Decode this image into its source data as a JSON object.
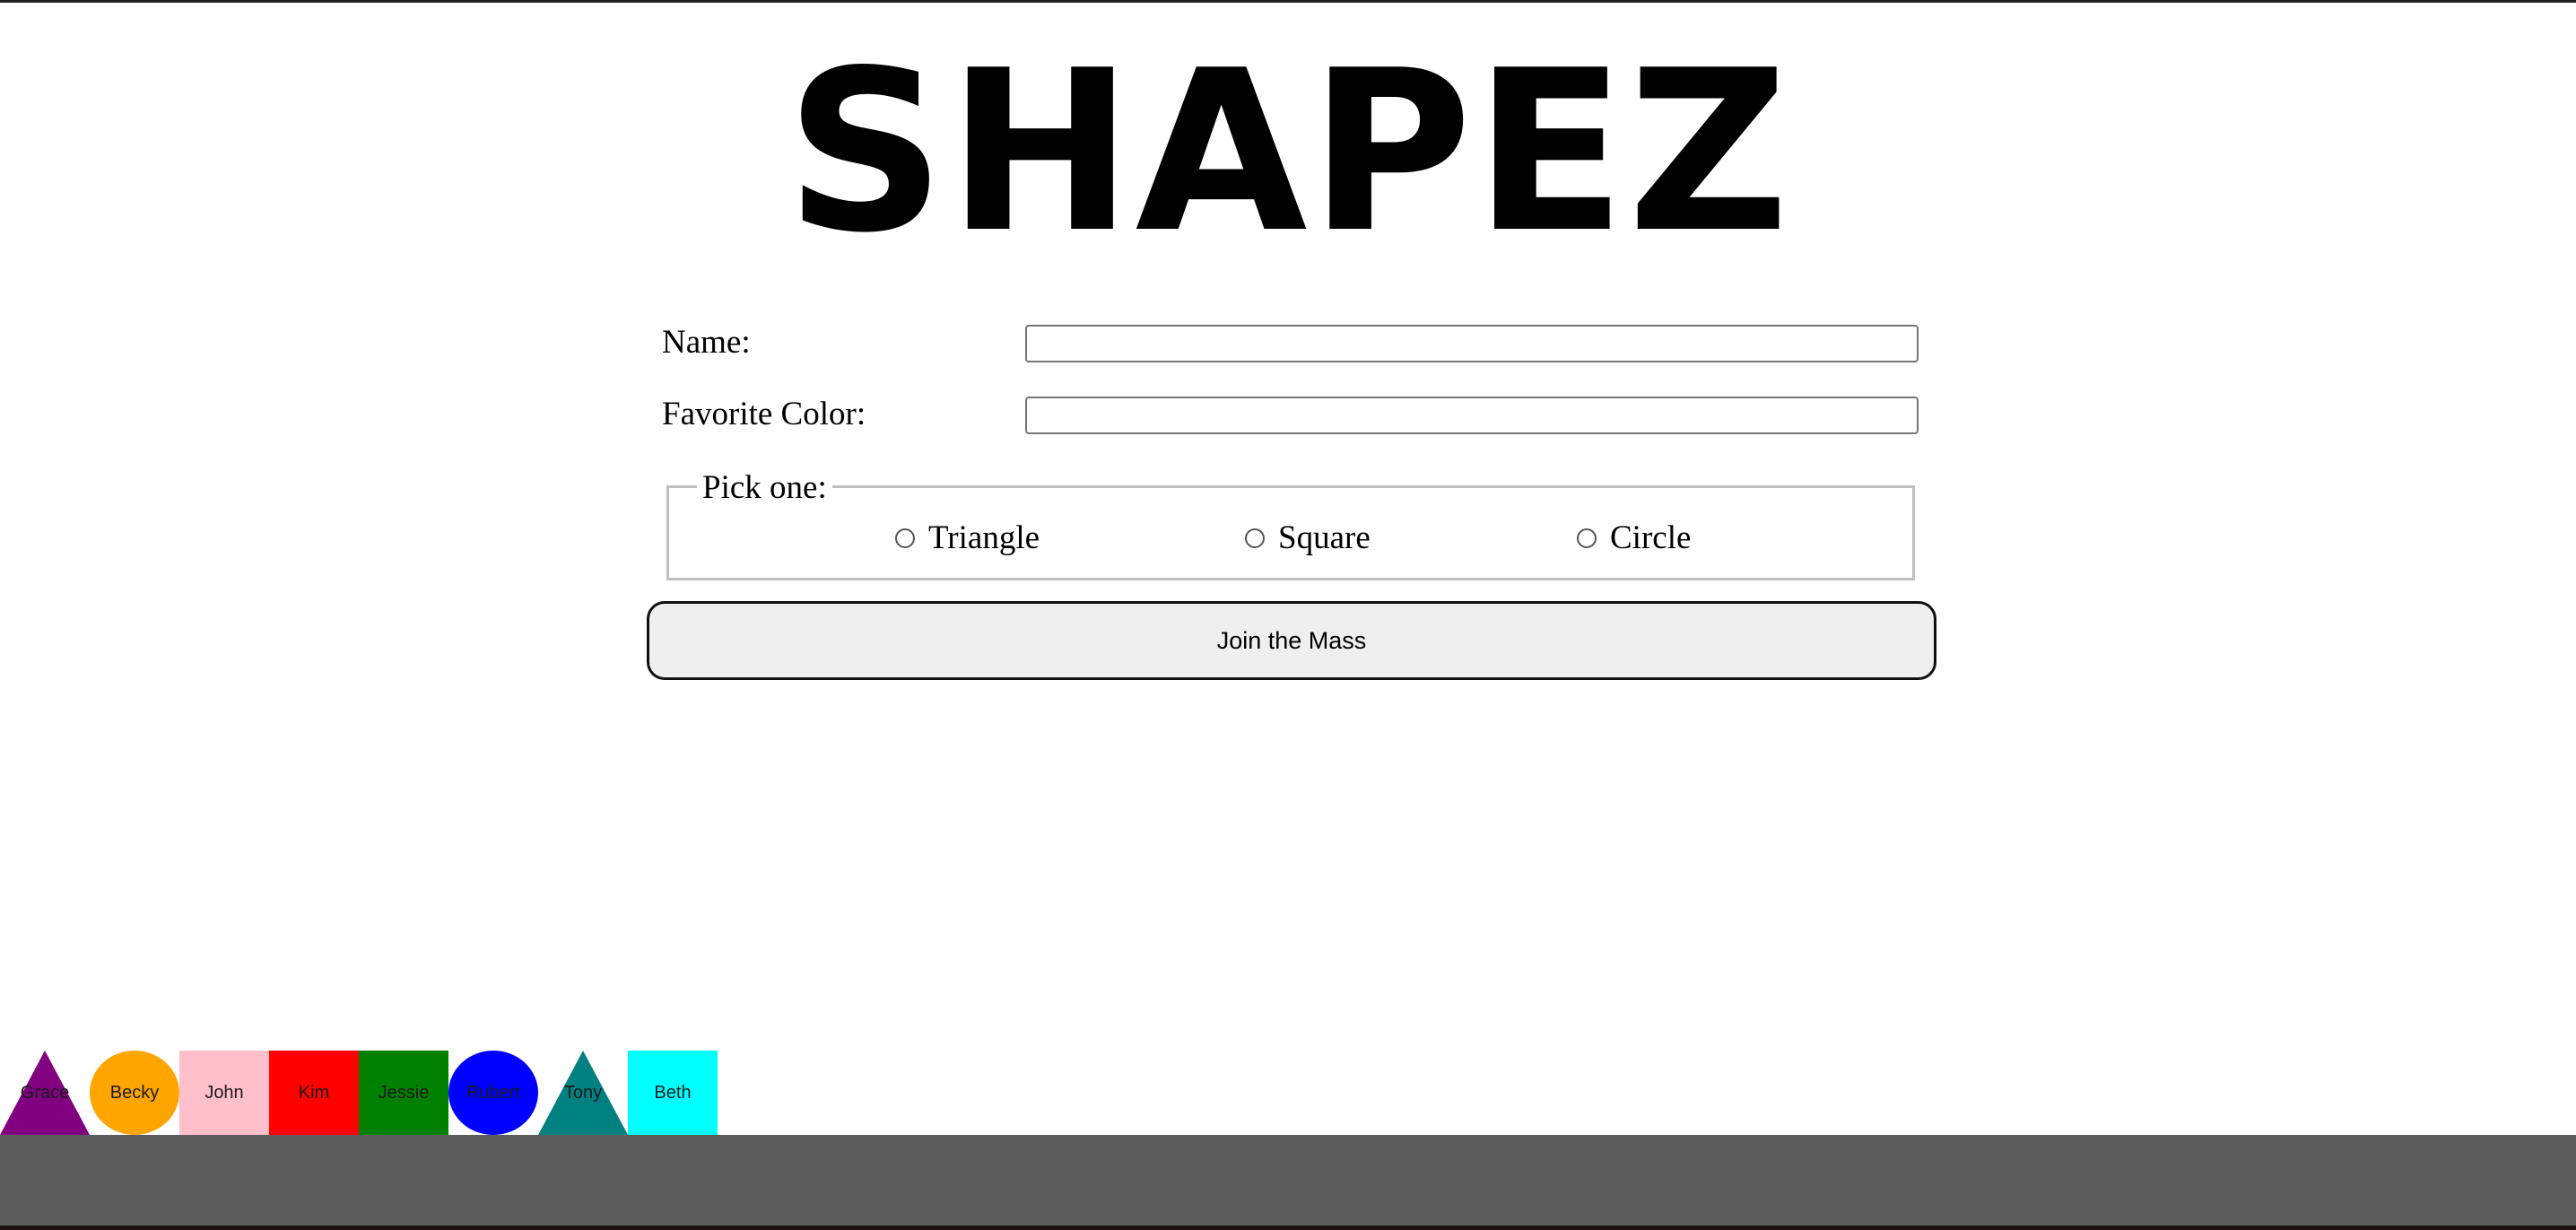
{
  "app": {
    "title": "SHAPEZ"
  },
  "form": {
    "name_label": "Name:",
    "name_value": "",
    "color_label": "Favorite Color:",
    "color_value": "",
    "shape_group_label": "Pick one:",
    "shape_options": [
      {
        "label": "Triangle",
        "selected": false
      },
      {
        "label": "Square",
        "selected": false
      },
      {
        "label": "Circle",
        "selected": false
      }
    ],
    "submit_label": "Join the Mass"
  },
  "members": [
    {
      "name": "Grace",
      "shape": "triangle",
      "color": "#800080"
    },
    {
      "name": "Becky",
      "shape": "circle",
      "color": "#FFA500"
    },
    {
      "name": "John",
      "shape": "square",
      "color": "#FFC0CB"
    },
    {
      "name": "Kim",
      "shape": "square",
      "color": "#FF0000"
    },
    {
      "name": "Jessie",
      "shape": "square",
      "color": "#008000"
    },
    {
      "name": "Rubert",
      "shape": "circle",
      "color": "#0000FF"
    },
    {
      "name": "Tony",
      "shape": "triangle",
      "color": "#008080"
    },
    {
      "name": "Beth",
      "shape": "square",
      "color": "#00FFFF"
    }
  ],
  "colors": {
    "footer": "#5C5C5C",
    "button_bg": "#EFEFEF"
  }
}
